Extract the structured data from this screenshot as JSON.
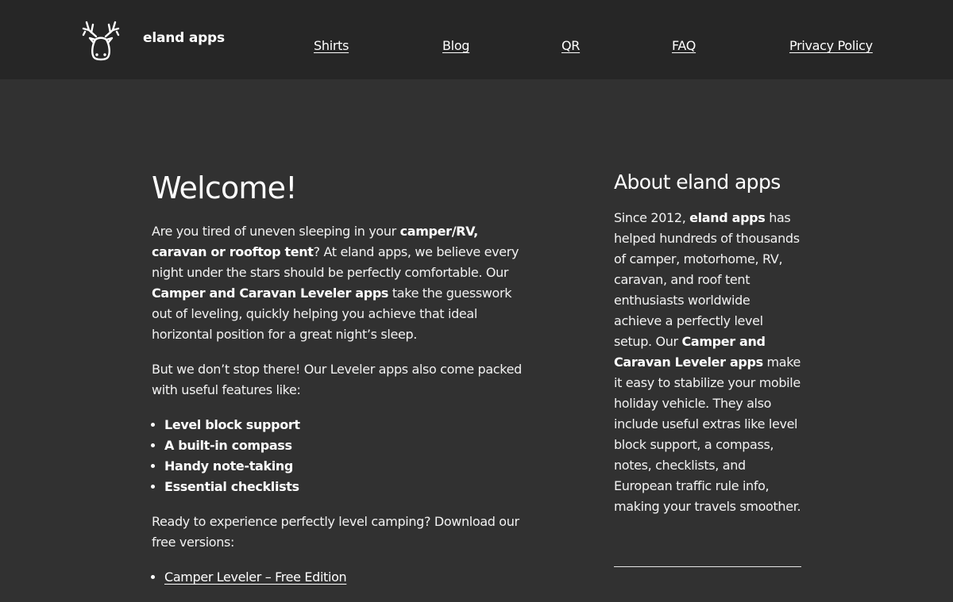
{
  "header": {
    "logo_icon": "deer-head-icon",
    "site_title": "eland apps",
    "nav": [
      "Shirts",
      "Blog",
      "QR",
      "FAQ",
      "Privacy Policy"
    ]
  },
  "main": {
    "title": "Welcome!",
    "intro": {
      "t1": "Are you tired of uneven sleeping in your ",
      "b1": "camper/RV, caravan or rooftop tent",
      "t2": "? At eland apps, we believe every night under the stars should be perfectly comfortable. Our ",
      "b2": "Camper and Caravan Leveler apps",
      "t3": " take the guesswork out of leveling, quickly helping you achieve that ideal horizontal position for a great night’s sleep."
    },
    "features_intro": "But we don’t stop there! Our Leveler apps also come packed with useful features like:",
    "features": [
      "Level block support",
      "A built-in compass",
      "Handy note-taking",
      "Essential checklists"
    ],
    "download_intro": "Ready to experience perfectly level camping? Download our free versions:",
    "downloads": [
      "Camper Leveler – Free Edition"
    ]
  },
  "sidebar": {
    "title": "About eland apps",
    "about": {
      "t1": "Since 2012, ",
      "b1": "eland apps",
      "t2": " has helped hundreds of thousands of camper, motorhome, RV, caravan, and roof tent enthusiasts worldwide achieve a perfectly level setup. Our ",
      "b2": "Camper and Caravan Leveler apps",
      "t3": " make it easy to stabilize your mobile holiday vehicle. They also include useful extras like level block support, a compass, notes, checklists, and European traffic rule info, making your travels smoother."
    }
  },
  "colors": {
    "header_bg": "#262626",
    "page_bg": "#313131",
    "text": "#ffffff"
  }
}
